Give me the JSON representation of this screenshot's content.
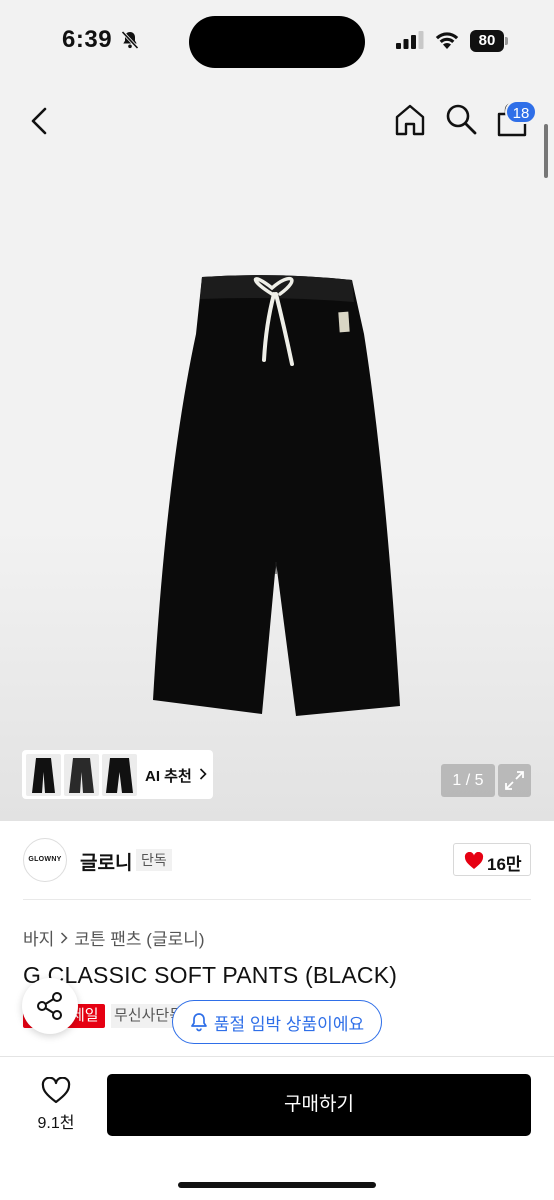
{
  "status_bar": {
    "time": "6:39",
    "battery": "80",
    "icons": [
      "bell-off-icon",
      "signal-icon",
      "wifi-icon",
      "battery-icon"
    ]
  },
  "header": {
    "icons": [
      "back-icon",
      "home-icon",
      "search-icon",
      "shopping-bag-icon"
    ],
    "cart_badge": "18"
  },
  "gallery": {
    "pager": "1 / 5",
    "ai_recommend_label": "AI 추천",
    "thumbnail_count": 3,
    "expand_icon": "expand-icon"
  },
  "brand": {
    "logo_text": "GLOWNY",
    "name": "글로니",
    "badge": "단독",
    "like_count": "16만",
    "heart_color": "#e60012"
  },
  "product": {
    "breadcrumb": [
      "바지",
      "코튼 팬츠 (글로니)"
    ],
    "title": "G CLASSIC SOFT PANTS (BLACK)",
    "sale_tag": "세일",
    "exclusive_tag": "무신사단독",
    "restock_notice": "품절 임박 상품이에요",
    "accent_color": "#2f6fe8"
  },
  "bottom_bar": {
    "wish_count": "9.1천",
    "buy_label": "구매하기"
  }
}
